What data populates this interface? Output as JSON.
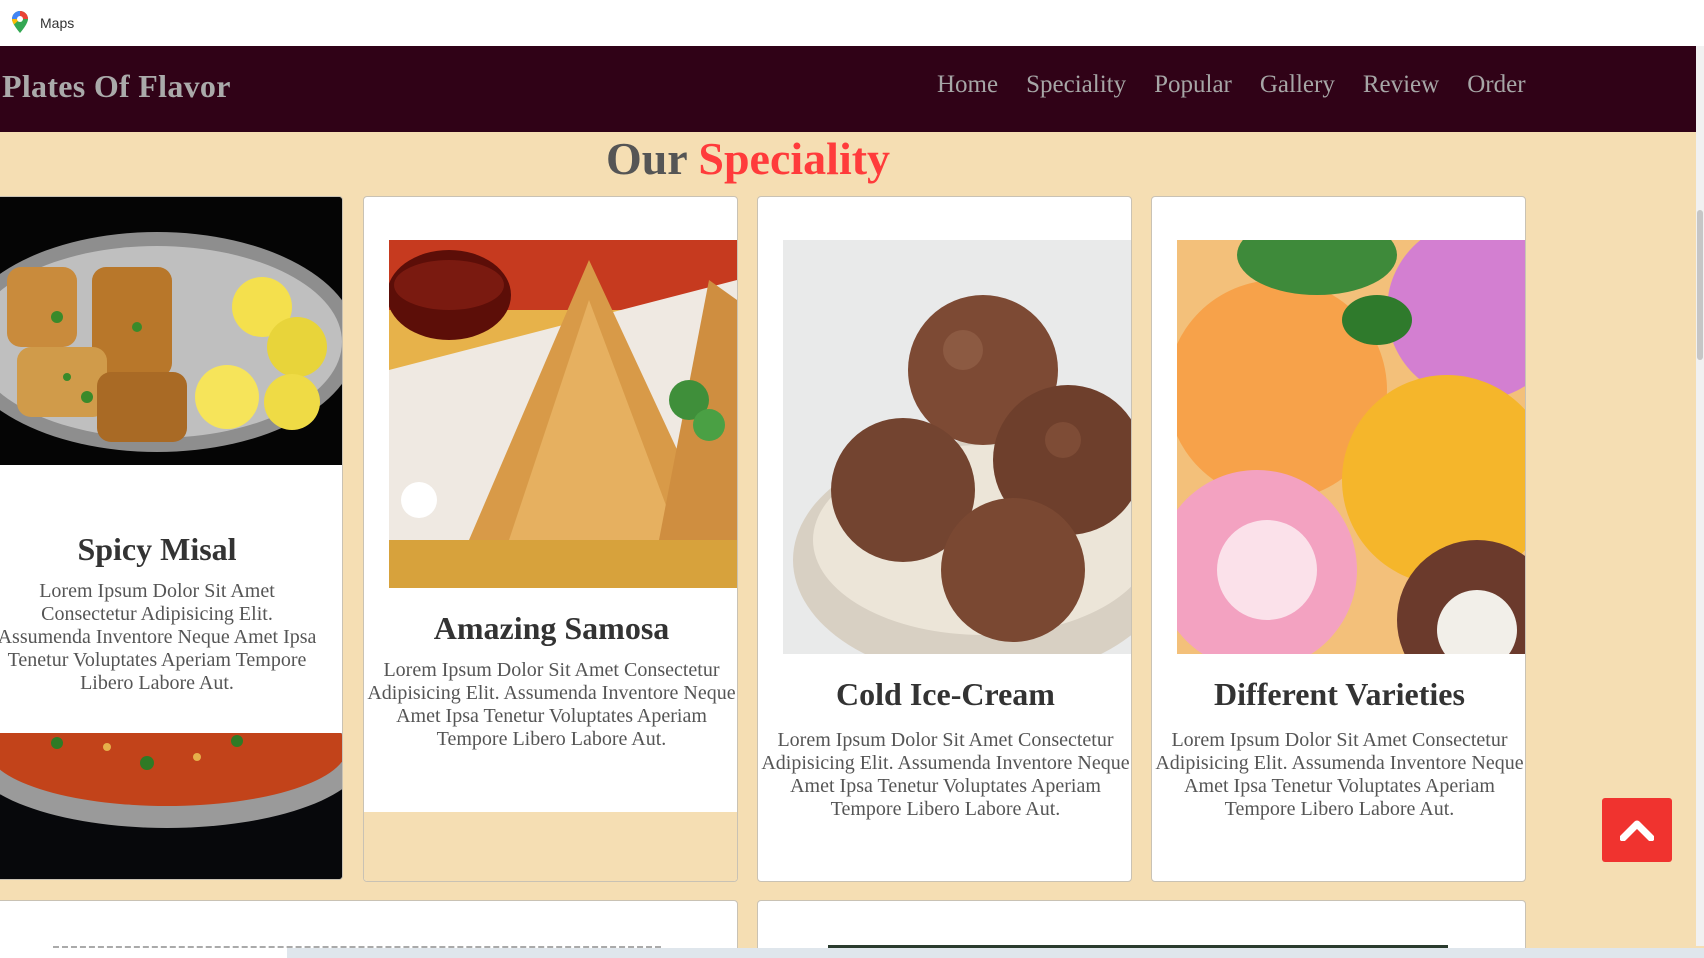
{
  "bookmarks": {
    "items": [
      {
        "label": "Maps",
        "icon": "maps-pin-icon"
      }
    ]
  },
  "header": {
    "logo": "Plates Of Flavor",
    "nav": [
      "Home",
      "Speciality",
      "Popular",
      "Gallery",
      "Review",
      "Order"
    ]
  },
  "section": {
    "heading_main": "Our ",
    "heading_accent": "Speciality",
    "accent_color": "#ff3b3b"
  },
  "cards": [
    {
      "title": "Spicy Misal",
      "desc": "Lorem Ipsum Dolor Sit Amet Consectetur Adipisicing Elit. Assumenda Inventore Neque Amet Ipsa Tenetur Voluptates Aperiam Tempore Libero Labore Aut.",
      "image": "spicy-misal-photo"
    },
    {
      "title": "Amazing Samosa",
      "desc": "Lorem Ipsum Dolor Sit Amet Consectetur Adipisicing Elit. Assumenda Inventore Neque Amet Ipsa Tenetur Voluptates Aperiam Tempore Libero Labore Aut.",
      "image": "samosa-photo"
    },
    {
      "title": "Cold Ice-Cream",
      "desc": "Lorem Ipsum Dolor Sit Amet Consectetur Adipisicing Elit. Assumenda Inventore Neque Amet Ipsa Tenetur Voluptates Aperiam Tempore Libero Labore Aut.",
      "image": "chocolate-ice-cream-photo"
    },
    {
      "title": "Different Varieties",
      "desc": "Lorem Ipsum Dolor Sit Amet Consectetur Adipisicing Elit. Assumenda Inventore Neque Amet Ipsa Tenetur Voluptates Aperiam Tempore Libero Labore Aut.",
      "image": "ice-cream-varieties-photo"
    }
  ],
  "colors": {
    "header_bg": "#300217",
    "page_bg": "#f5deb3",
    "accent": "#ff3b3b",
    "to_top_bg": "#f0332f"
  },
  "to_top": {
    "icon": "chevron-up-icon"
  }
}
